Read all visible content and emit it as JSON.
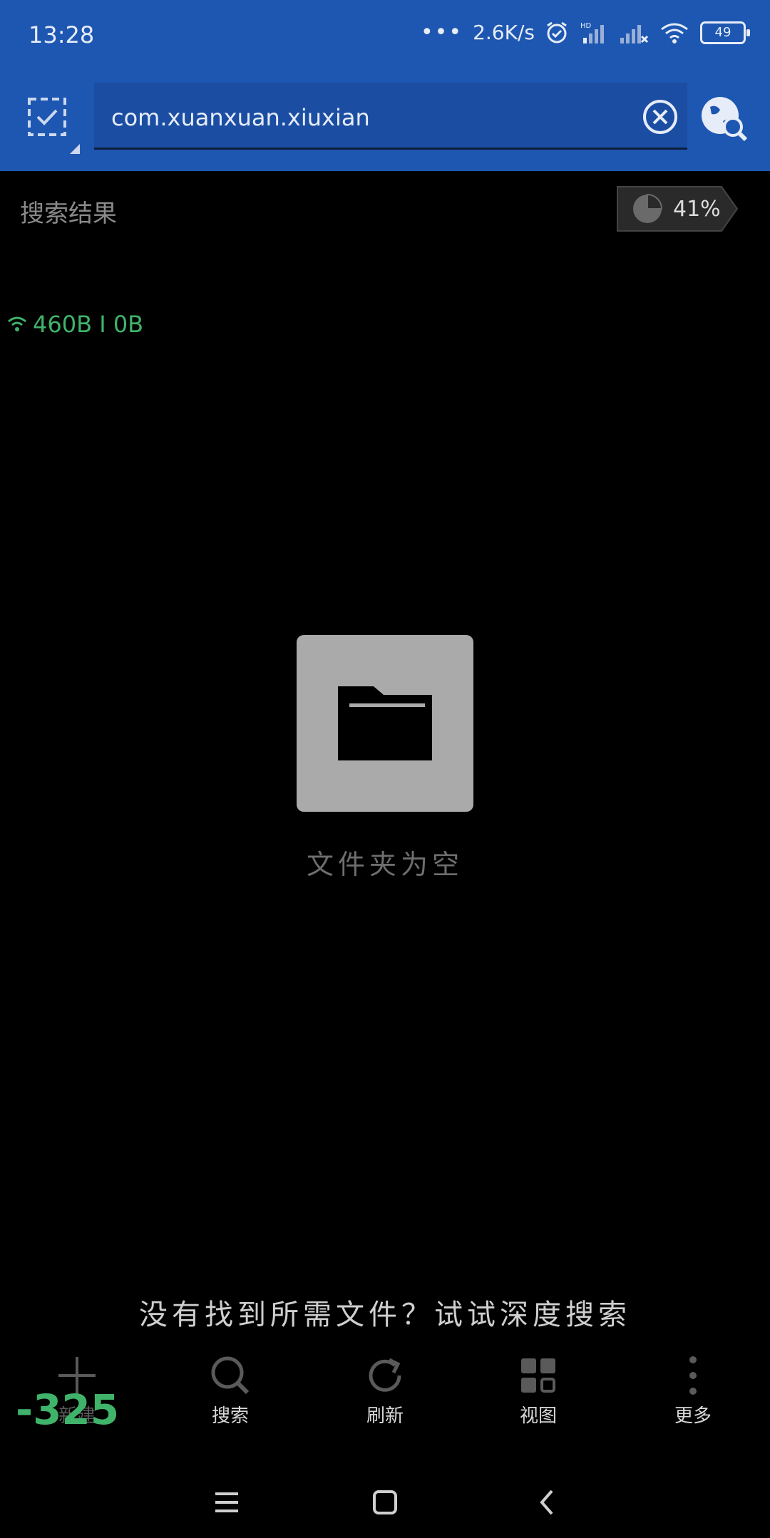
{
  "status_bar": {
    "time": "13:28",
    "speed": "2.6K/s",
    "battery": "49"
  },
  "toolbar": {
    "search": {
      "value": "com.xuanxuan.xiuxian",
      "placeholder": ""
    }
  },
  "content": {
    "results_label": "搜索结果",
    "storage_percent": "41%",
    "net_speed": "460B I 0B",
    "empty_text": "文件夹为空",
    "deep_search_prompt": "没有找到所需文件？试试深度搜索"
  },
  "bottom_bar": {
    "items": [
      {
        "label": "新建",
        "icon": "plus-icon"
      },
      {
        "label": "搜索",
        "icon": "search-icon"
      },
      {
        "label": "刷新",
        "icon": "refresh-icon"
      },
      {
        "label": "视图",
        "icon": "grid-view-icon"
      },
      {
        "label": "更多",
        "icon": "more-vertical-icon"
      }
    ],
    "counter": "-325"
  },
  "colors": {
    "header_blue": "#1e57b1",
    "accent_green": "#3fb36a",
    "background": "#000000"
  }
}
